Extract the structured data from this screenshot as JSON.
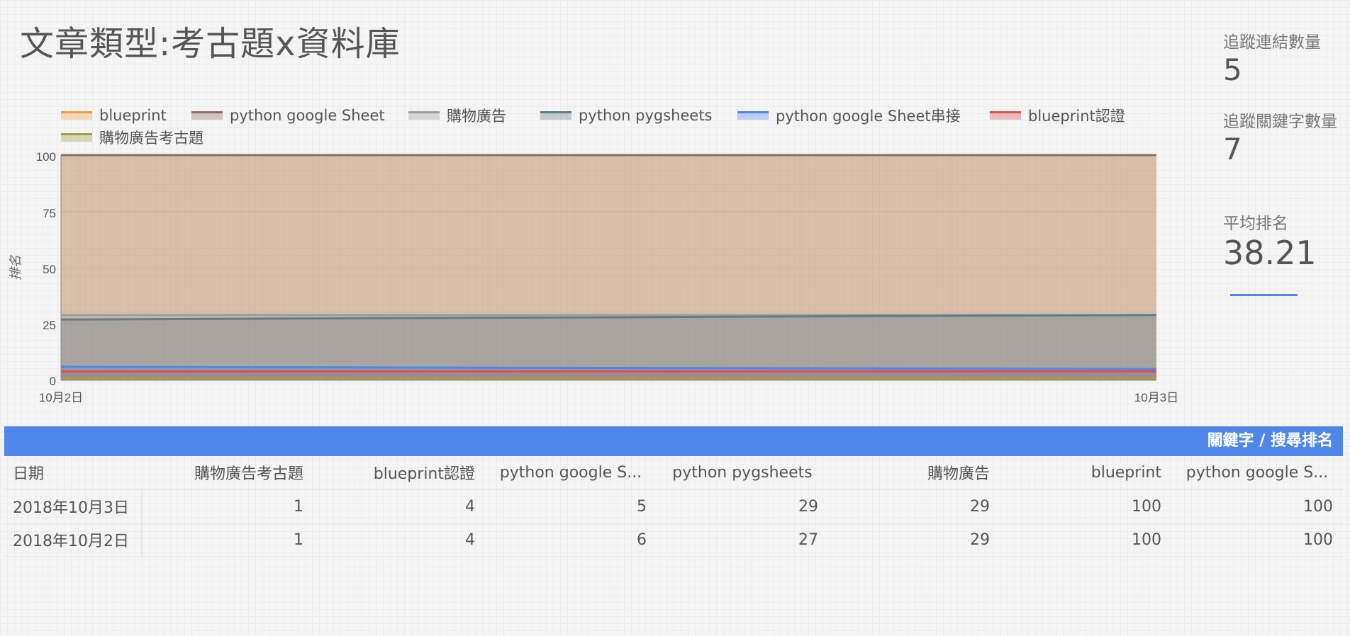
{
  "page": {
    "title": "文章類型:考古題x資料庫"
  },
  "kpis": [
    {
      "label": "追蹤連結數量",
      "value": "5"
    },
    {
      "label": "追蹤關鍵字數量",
      "value": "7"
    },
    {
      "label": "平均排名",
      "value": "38.21"
    }
  ],
  "colors": {
    "blueprint": "#f0a050",
    "python_google_sheet": "#8d6e63",
    "shopping_ads": "#9e9e9e",
    "python_pygsheets": "#607d8b",
    "python_google_sheet_connect": "#4f86e8",
    "blueprint_cert": "#d9534f",
    "shopping_ads_exam": "#a0a040",
    "table_header": "#4f86e8"
  },
  "chart_data": {
    "type": "area",
    "x": [
      "10月2日",
      "10月3日"
    ],
    "ylabel": "排名",
    "ylim": [
      0,
      100
    ],
    "yticks": [
      "0",
      "25",
      "50",
      "75",
      "100"
    ],
    "legend_position": "top",
    "series": [
      {
        "name": "blueprint",
        "values": [
          100,
          100
        ],
        "color": "#f0a050"
      },
      {
        "name": "python google Sheet",
        "values": [
          100,
          100
        ],
        "color": "#8d6e63"
      },
      {
        "name": "購物廣告",
        "values": [
          29,
          29
        ],
        "color": "#9e9e9e"
      },
      {
        "name": "python pygsheets",
        "values": [
          27,
          29
        ],
        "color": "#607d8b"
      },
      {
        "name": "python google Sheet串接",
        "values": [
          6,
          5
        ],
        "color": "#4f86e8"
      },
      {
        "name": "blueprint認證",
        "values": [
          4,
          4
        ],
        "color": "#d9534f"
      },
      {
        "name": "購物廣告考古題",
        "values": [
          1,
          1
        ],
        "color": "#a0a040"
      }
    ]
  },
  "table": {
    "group_header": "關鍵字 / 搜尋排名",
    "columns": [
      "日期",
      "購物廣告考古題",
      "blueprint認證",
      "python google S...",
      "python pygsheets",
      "購物廣告",
      "blueprint",
      "python google S..."
    ],
    "rows": [
      [
        "2018年10月3日",
        "1",
        "4",
        "5",
        "29",
        "29",
        "100",
        "100"
      ],
      [
        "2018年10月2日",
        "1",
        "4",
        "6",
        "27",
        "29",
        "100",
        "100"
      ]
    ]
  }
}
